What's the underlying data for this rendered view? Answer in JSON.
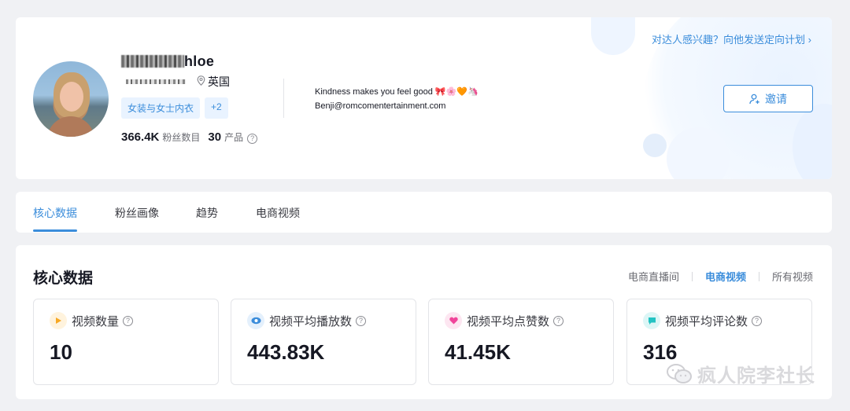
{
  "profile": {
    "name_suffix": "hloe",
    "location": "英国",
    "tags": [
      "女装与女士内衣",
      "+2"
    ],
    "followers_value": "366.4K",
    "followers_label": "粉丝数目",
    "products_value": "30",
    "products_label": "产品",
    "bio_line1": "Kindness makes you feel good 🎀🌸🧡🦄",
    "bio_line2": "Benji@romcomentertainment.com",
    "promo_text": "对达人感兴趣？向他发送定向计划 ›",
    "invite_label": "邀请"
  },
  "tabs": [
    "核心数据",
    "粉丝画像",
    "趋势",
    "电商视频"
  ],
  "core": {
    "title": "核心数据",
    "filters": [
      "电商直播间",
      "电商视频",
      "所有视频"
    ],
    "active_filter": "电商视频",
    "metrics": [
      {
        "label": "视频数量",
        "value": "10",
        "icon": "play-icon",
        "color": "#f7a823"
      },
      {
        "label": "视频平均播放数",
        "value": "443.83K",
        "icon": "eye-icon",
        "color": "#3b8ddb"
      },
      {
        "label": "视频平均点赞数",
        "value": "41.45K",
        "icon": "heart-icon",
        "color": "#f0449a"
      },
      {
        "label": "视频平均评论数",
        "value": "316",
        "icon": "comment-icon",
        "color": "#22c3c3"
      }
    ]
  },
  "watermark": "疯人院李社长"
}
